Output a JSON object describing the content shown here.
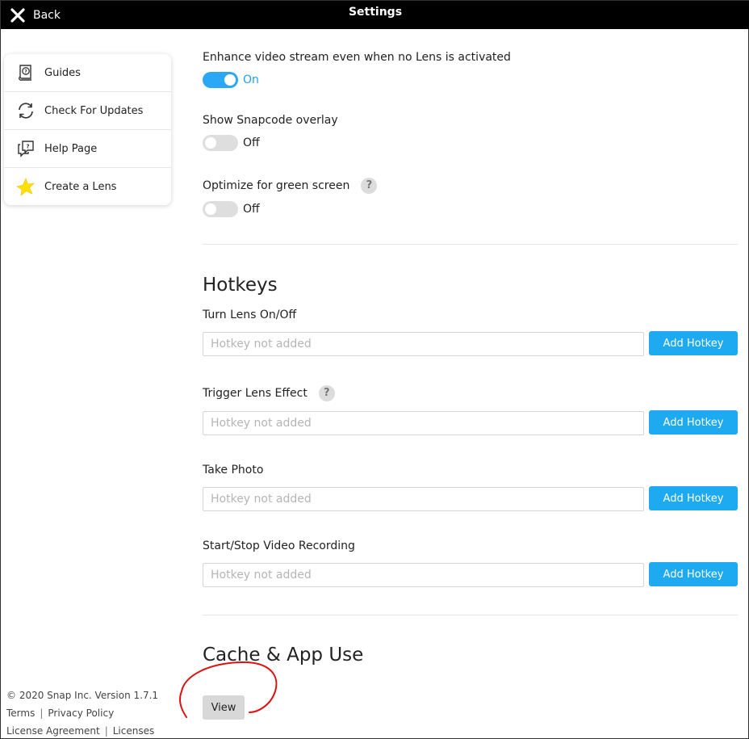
{
  "window": {
    "title": "Settings",
    "back_label": "Back"
  },
  "sidebar": {
    "items": [
      {
        "label": "Guides",
        "icon": "guides-icon"
      },
      {
        "label": "Check For Updates",
        "icon": "refresh-icon"
      },
      {
        "label": "Help Page",
        "icon": "help-chat-icon"
      },
      {
        "label": "Create a Lens",
        "icon": "lens-star-icon"
      }
    ]
  },
  "footer": {
    "copyright": "© 2020 Snap Inc. Version 1.7.1",
    "links": [
      "Terms",
      "Privacy Policy",
      "License Agreement",
      "Licenses"
    ],
    "separator": "|"
  },
  "settings": {
    "enhance": {
      "label": "Enhance video stream even when no Lens is activated",
      "state": "On"
    },
    "snapcode": {
      "label": "Show Snapcode overlay",
      "state": "Off"
    },
    "green_screen": {
      "label": "Optimize for green screen",
      "state": "Off",
      "help": "?"
    }
  },
  "hotkeys": {
    "title": "Hotkeys",
    "items": [
      {
        "label": "Turn Lens On/Off",
        "placeholder": "Hotkey not added",
        "button": "Add Hotkey"
      },
      {
        "label": "Trigger Lens Effect",
        "placeholder": "Hotkey not added",
        "button": "Add Hotkey",
        "help": "?"
      },
      {
        "label": "Take Photo",
        "placeholder": "Hotkey not added",
        "button": "Add Hotkey"
      },
      {
        "label": "Start/Stop Video Recording",
        "placeholder": "Hotkey not added",
        "button": "Add Hotkey"
      }
    ]
  },
  "cache": {
    "title": "Cache & App Use",
    "view_button": "View"
  },
  "colors": {
    "accent": "#1eaaf1",
    "titlebar": "#000000",
    "annotation": "#e01010"
  }
}
